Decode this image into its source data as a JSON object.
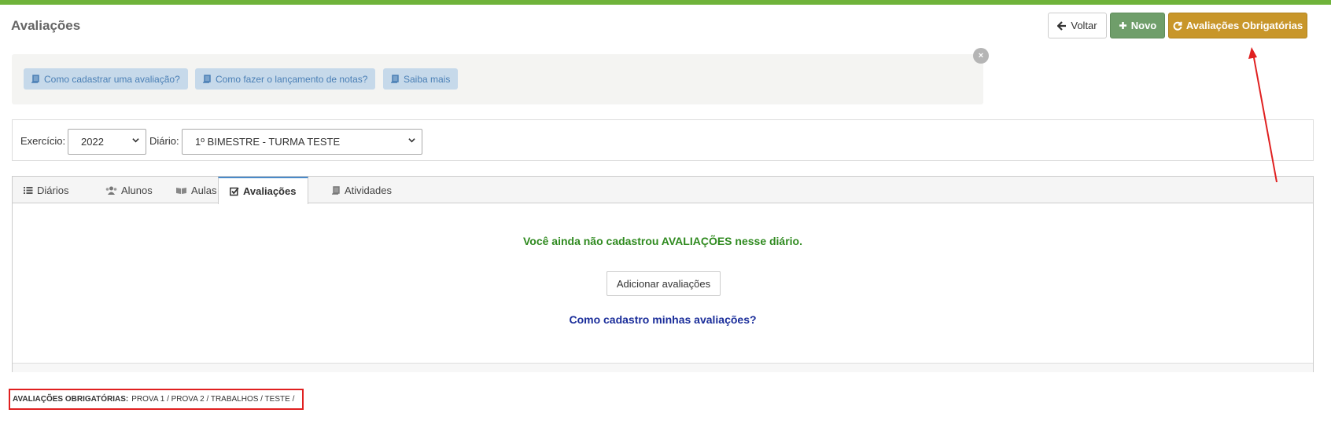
{
  "page_title": "Avaliações",
  "toolbar": {
    "back_label": "Voltar",
    "new_label": "Novo",
    "required_label": "Avaliações Obrigatórias"
  },
  "help": {
    "links": [
      "Como cadastrar uma avaliação?",
      "Como fazer o lançamento de notas?",
      "Saiba mais"
    ],
    "close_glyph": "×"
  },
  "filters": {
    "year_label": "Exercício:",
    "year_value": "2022",
    "diary_label": "Diário:",
    "diary_value": "1º BIMESTRE - TURMA TESTE"
  },
  "tabs": [
    {
      "label": "Diários",
      "icon": "list-icon"
    },
    {
      "label": "Alunos",
      "icon": "users-icon"
    },
    {
      "label": "Aulas",
      "icon": "open-book-icon"
    },
    {
      "label": "Avaliações",
      "icon": "checkbox-icon",
      "active": true
    },
    {
      "label": "Atividades",
      "icon": "book-icon"
    }
  ],
  "content": {
    "empty_message": "Você ainda não cadastrou AVALIAÇÕES nesse diário.",
    "add_button": "Adicionar avaliações",
    "how_link": "Como cadastro minhas avaliações?"
  },
  "required_note": {
    "label": "AVALIAÇÕES OBRIGATÓRIAS:",
    "items": "PROVA 1 / PROVA 2 / TRABALHOS / TESTE /"
  },
  "colors": {
    "topbar": "#6fb33a",
    "new_button": "#6f9e6a",
    "required_button": "#c8962a",
    "empty_message": "#2f8a1f",
    "how_link": "#1a2d9a",
    "annotation": "#e02020"
  }
}
